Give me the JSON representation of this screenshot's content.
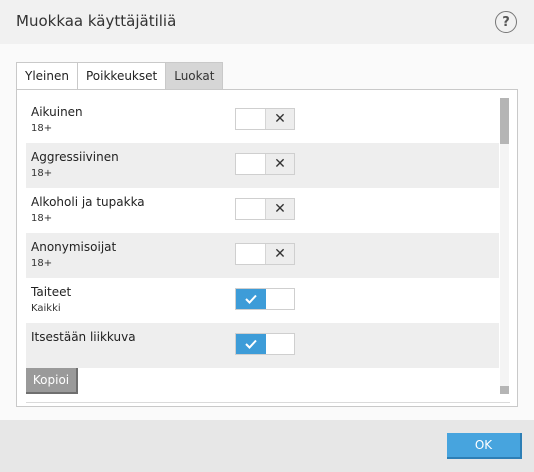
{
  "window": {
    "title": "Muokkaa käyttäjätiliä",
    "help_label": "?"
  },
  "tabs": [
    {
      "label": "Yleinen",
      "active": false
    },
    {
      "label": "Poikkeukset",
      "active": false
    },
    {
      "label": "Luokat",
      "active": true
    }
  ],
  "categories": [
    {
      "name": "Aikuinen",
      "age": "18+",
      "enabled": false
    },
    {
      "name": "Aggressiivinen",
      "age": "18+",
      "enabled": false
    },
    {
      "name": "Alkoholi ja tupakka",
      "age": "18+",
      "enabled": false
    },
    {
      "name": "Anonymisoijat",
      "age": "18+",
      "enabled": false
    },
    {
      "name": "Taiteet",
      "age": "Kaikki",
      "enabled": true
    },
    {
      "name": "Itsestään liikkuva",
      "age": "",
      "enabled": true
    }
  ],
  "buttons": {
    "copy_label": "Kopioi",
    "ok_label": "OK"
  },
  "colors": {
    "accent": "#47a4de",
    "toggle_on": "#3d9cd8",
    "alt_row": "#eeeeee"
  }
}
